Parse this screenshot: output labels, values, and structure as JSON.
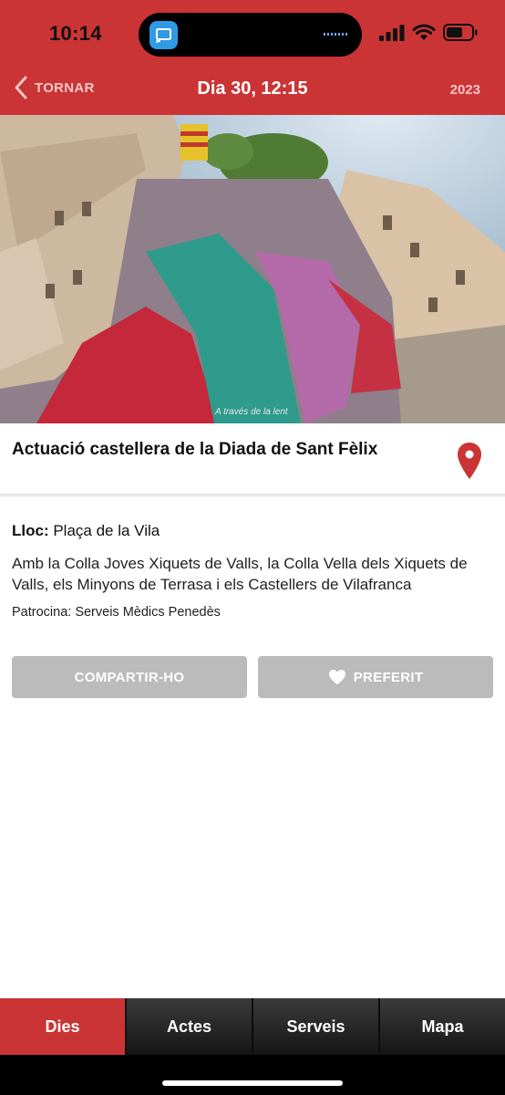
{
  "status_bar": {
    "time": "10:14"
  },
  "nav": {
    "back_label": "TORNAR",
    "title": "Dia 30, 12:15",
    "year": "2023"
  },
  "hero": {
    "credit": "A través de la lent"
  },
  "event": {
    "title": "Actuació castellera de la Diada de Sant Fèlix",
    "location_label": "Lloc:",
    "location": "Plaça de la Vila",
    "description": "Amb la Colla Joves Xiquets de Valls, la Colla Vella dels Xiquets de Valls, els Minyons de Terrasa i els Castellers de Vilafranca",
    "sponsor": "Patrocina: Serveis Mèdics Penedès"
  },
  "actions": {
    "share_label": "COMPARTIR-HO",
    "favorite_label": "PREFERIT"
  },
  "tabs": [
    {
      "label": "Dies",
      "active": true
    },
    {
      "label": "Actes",
      "active": false
    },
    {
      "label": "Serveis",
      "active": false
    },
    {
      "label": "Mapa",
      "active": false
    }
  ],
  "colors": {
    "brand_red": "#cb3434",
    "button_gray": "#bbbbbb",
    "tabbar_dark": "#2a2a2a"
  }
}
